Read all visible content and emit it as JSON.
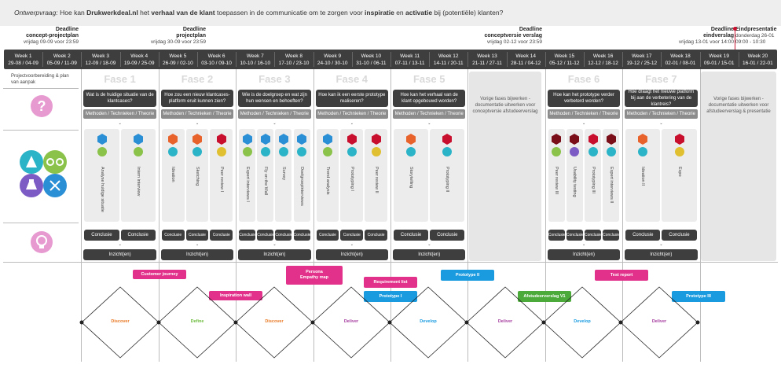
{
  "header": {
    "question_prefix": "Ontwerpvraag:",
    "question_a": " Hoe kan ",
    "question_brand": "Drukwerkdeal.nl",
    "question_b": " het ",
    "question_c": "verhaal van de klant",
    "question_d": " toepassen in de communicatie om te zorgen voor ",
    "question_e": "inspiratie",
    "question_f": " en ",
    "question_g": "activatie",
    "question_h": " bij (potentiële) klanten?"
  },
  "deadlines": [
    {
      "t1": "Deadline",
      "t2": "concept-projectplan",
      "t3": "vrijdag 09-09 voor 23:59"
    },
    {
      "t1": "Deadline",
      "t2": "projectplan",
      "t3": "vrijdag 30-09 voor 23:59"
    },
    {
      "t1": "Deadline",
      "t2": "conceptversie verslag",
      "t3": "vrijdag 02-12 voor 23:59"
    },
    {
      "t1": "Deadline",
      "t2": "eindverslag",
      "t3": "vrijdag 13-01 voor 14:00"
    },
    {
      "t1": "Eindpresentatie",
      "t2": "donderdag 26-01",
      "t3": "09:00 - 10:30"
    }
  ],
  "weeks": [
    {
      "w": "Week 1",
      "d": "29-08 / 04-09"
    },
    {
      "w": "Week 2",
      "d": "05-09 / 11-09"
    },
    {
      "w": "Week 3",
      "d": "12-09 / 18-09"
    },
    {
      "w": "Week 4",
      "d": "19-09 / 25-09"
    },
    {
      "w": "Week 5",
      "d": "26-09 / 02-10"
    },
    {
      "w": "Week 6",
      "d": "03-10 / 09-10"
    },
    {
      "w": "Week 7",
      "d": "10-10 / 16-10"
    },
    {
      "w": "Week 8",
      "d": "17-10 / 23-10"
    },
    {
      "w": "Week 9",
      "d": "24-10 / 30-10"
    },
    {
      "w": "Week 10",
      "d": "31-10 / 06-11"
    },
    {
      "w": "Week 11",
      "d": "07-11 / 13-11"
    },
    {
      "w": "Week 12",
      "d": "14-11 / 20-11"
    },
    {
      "w": "Week 13",
      "d": "21-11 / 27-11"
    },
    {
      "w": "Week 14",
      "d": "28-11 / 04-12"
    },
    {
      "w": "Week 15",
      "d": "05-12 / 11-12"
    },
    {
      "w": "Week 16",
      "d": "12-12 / 18-12"
    },
    {
      "w": "Week 17",
      "d": "19-12 / 25-12"
    },
    {
      "w": "Week 18",
      "d": "02-01 / 08-01"
    },
    {
      "w": "Week 19",
      "d": "09-01 / 15-01"
    },
    {
      "w": "Week 20",
      "d": "16-01 / 22-01"
    }
  ],
  "prep_label": "Projectvoorbereiding & plan van aanpak",
  "phases": [
    {
      "name": "Fase 1",
      "question": "Wat is de huidige situatie van de klantcases?"
    },
    {
      "name": "Fase 2",
      "question": "Hoe zou een nieuw klantcases-platform eruit kunnen zien?"
    },
    {
      "name": "Fase 3",
      "question": "Wie is de doelgroep en wat zijn hun wensen en behoeften?"
    },
    {
      "name": "Fase 4",
      "question": "Hoe kan ik een eerste prototype realiseren?"
    },
    {
      "name": "Fase 5",
      "question": "Hoe kan het verhaal van de klant opgebouwd worden?"
    },
    {
      "name": "Fase 6",
      "question": "Hoe kan het prototype verder verbeterd worden?"
    },
    {
      "name": "Fase 7",
      "question": "Hoe draagt het nieuwe platform bij aan de verbetering van de klantreis?"
    }
  ],
  "methods_label": "Methoden / Technieken / Theorie",
  "conclusie": "Conclusie",
  "inzicht": "Inzicht(en)",
  "methods": [
    "Analyse huidige situatie",
    "Intern interview",
    "Ideation",
    "Sketching",
    "Peer review I",
    "Expert interviews I",
    "Fly on the Wall",
    "Survey",
    "Doelgroepinterviews",
    "Trend analysis",
    "Prototyping I",
    "Peer review II",
    "Storytelling",
    "Prototyping II",
    "Peer review III",
    "Usability testing",
    "Prototyping III",
    "Expert interviews II",
    "Ideation II",
    "Expo"
  ],
  "notes": [
    "Vorige fases bijwerken - documentatie uitwerken voor conceptversie afstudeerverslag",
    "Vorige fases bijwerken - documentatie uitwerken voor afstudeerverslag & presentatie"
  ],
  "deliverables": [
    {
      "label": "Customer journey",
      "color": "#e2318a"
    },
    {
      "label": "Inspiration wall",
      "color": "#e2318a"
    },
    {
      "label": "Persona",
      "color": "#e2318a"
    },
    {
      "label": "Empathy map",
      "color": "#e2318a"
    },
    {
      "label": "Requirement list",
      "color": "#e2318a"
    },
    {
      "label": "Prototype I",
      "color": "#1a9be0"
    },
    {
      "label": "Prototype II",
      "color": "#1a9be0"
    },
    {
      "label": "Afstudeerverslag V1",
      "color": "#4caa3a"
    },
    {
      "label": "Test report",
      "color": "#e2318a"
    },
    {
      "label": "Prototype III",
      "color": "#1a9be0"
    }
  ],
  "diamond_labels": [
    {
      "t": "Discover",
      "c": "#e87722"
    },
    {
      "t": "Define",
      "c": "#6cbb3c"
    },
    {
      "t": "Discover",
      "c": "#e87722"
    },
    {
      "t": "Deliver",
      "c": "#a63fa0"
    },
    {
      "t": "Develop",
      "c": "#1a9be0"
    },
    {
      "t": "Deliver",
      "c": "#a63fa0"
    },
    {
      "t": "Develop",
      "c": "#1a9be0"
    },
    {
      "t": "Deliver",
      "c": "#a63fa0"
    }
  ],
  "colors": {
    "dark": "#3e3e3e",
    "pink": "#e2318a",
    "blue": "#1a9be0",
    "green": "#4caa3a",
    "red": "#c8102e"
  }
}
